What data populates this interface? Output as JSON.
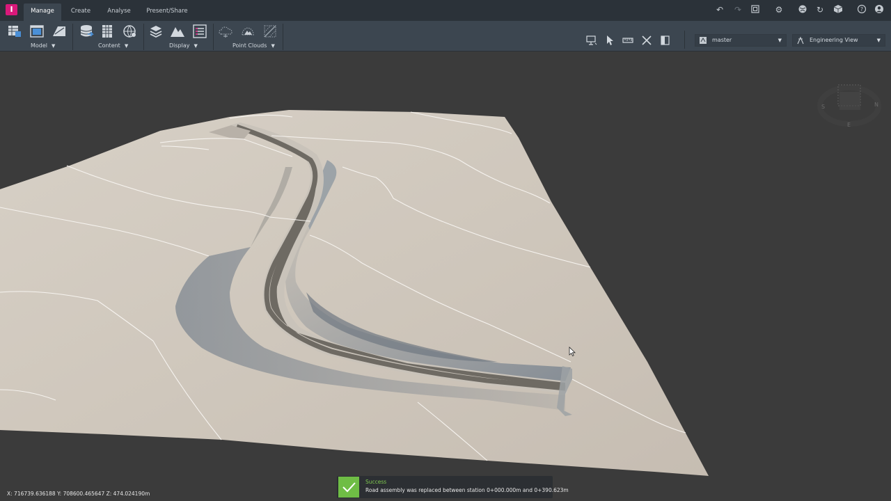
{
  "app": {
    "logo_letter": "I"
  },
  "tabs": [
    {
      "label": "Manage",
      "active": true
    },
    {
      "label": "Create",
      "active": false
    },
    {
      "label": "Analyse",
      "active": false
    },
    {
      "label": "Present/Share",
      "active": false
    }
  ],
  "toolbar_icons": [
    "undo-icon",
    "redo-icon",
    "fullscreen-icon",
    "settings-icon",
    "globe-icon",
    "sync-icon",
    "cube-icon",
    "help-icon",
    "user-icon"
  ],
  "ribbon": {
    "groups": [
      {
        "label": "Model",
        "icons": [
          "model-table-icon",
          "model-view-icon",
          "model-map-icon"
        ]
      },
      {
        "label": "Content",
        "icons": [
          "database-icon",
          "grid-icon",
          "network-globe-icon"
        ]
      },
      {
        "label": "Display",
        "icons": [
          "layers-icon",
          "terrain-icon",
          "list-icon"
        ]
      },
      {
        "label": "Point Clouds",
        "icons": [
          "point-cloud-icon",
          "point-cloud-terrain-icon",
          "point-cloud-scan-icon"
        ]
      }
    ],
    "tools": [
      "presentation-icon",
      "select-arrow-icon",
      "measure-icon",
      "cut-icon",
      "split-view-icon"
    ],
    "branch_select": {
      "value": "master",
      "icon": "proposal-icon"
    },
    "view_select": {
      "value": "Engineering View",
      "icon": "engineering-view-icon"
    }
  },
  "viewcube": {
    "labels": [
      "S",
      "N",
      "E"
    ]
  },
  "status": {
    "coordinates": "X: 716739.636188 Y: 708600.465647 Z: 474.024190m"
  },
  "toast": {
    "title": "Success",
    "message": "Road assembly was replaced between station 0+000.000m and 0+390.623m"
  },
  "colors": {
    "accent": "#d9197a",
    "tabbar": "#2b3239",
    "ribbon": "#3c4650",
    "viewport": "#3b3b3b",
    "terrain": "#cfc7bd",
    "road": "#6e6a63",
    "success": "#6fbd45"
  }
}
